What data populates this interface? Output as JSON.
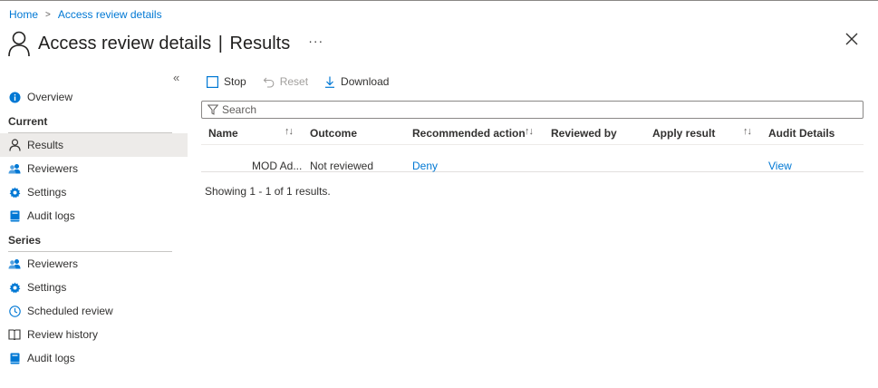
{
  "breadcrumb": {
    "home": "Home",
    "current": "Access review details"
  },
  "header": {
    "title": "Access review details",
    "separator": "|",
    "subtitle": "Results",
    "more": "···"
  },
  "sidebar": {
    "collapse": "«",
    "top": [
      {
        "label": "Overview",
        "icon": "info-icon"
      }
    ],
    "sections": [
      {
        "label": "Current",
        "items": [
          {
            "label": "Results",
            "icon": "person-icon",
            "active": true
          },
          {
            "label": "Reviewers",
            "icon": "users-icon"
          },
          {
            "label": "Settings",
            "icon": "gear-icon"
          },
          {
            "label": "Audit logs",
            "icon": "book-icon"
          }
        ]
      },
      {
        "label": "Series",
        "items": [
          {
            "label": "Reviewers",
            "icon": "users-icon"
          },
          {
            "label": "Settings",
            "icon": "gear-icon"
          },
          {
            "label": "Scheduled review",
            "icon": "clock-icon"
          },
          {
            "label": "Review history",
            "icon": "open-book-icon"
          },
          {
            "label": "Audit logs",
            "icon": "book-icon"
          }
        ]
      }
    ]
  },
  "toolbar": {
    "stop": "Stop",
    "reset": "Reset",
    "download": "Download"
  },
  "search": {
    "placeholder": "Search"
  },
  "table": {
    "columns": [
      "Name",
      "Outcome",
      "Recommended action",
      "Reviewed by",
      "Apply result",
      "Audit Details"
    ],
    "rows": [
      {
        "name": "MOD Ad...",
        "outcome": "Not reviewed",
        "recommended": "Deny",
        "reviewed_by": "",
        "apply_result": "",
        "audit": "View"
      }
    ]
  },
  "footer": {
    "status": "Showing 1 - 1 of 1 results."
  },
  "colors": {
    "link": "#0078d4",
    "active_bg": "#edebe9",
    "icon_blue": "#0078d4"
  }
}
